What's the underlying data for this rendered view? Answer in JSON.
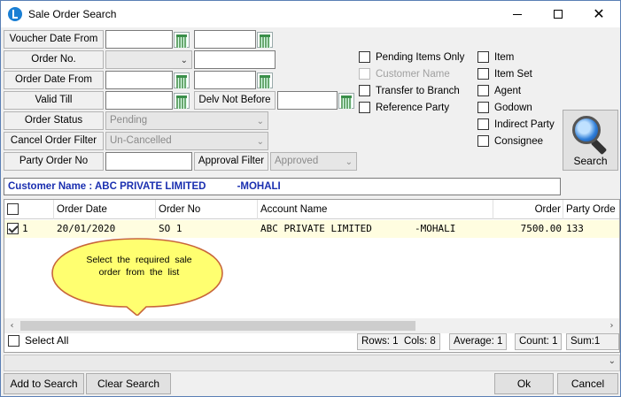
{
  "window": {
    "title": "Sale Order Search",
    "minimize_glyph": "",
    "maximize_glyph": "",
    "close_glyph": "✕"
  },
  "filters": {
    "voucher_date_from_label": "Voucher Date From",
    "order_no_label": "Order No.",
    "order_date_from_label": "Order Date From",
    "valid_till_label": "Valid Till",
    "delv_not_before_label": "Delv Not Before",
    "order_status_label": "Order Status",
    "order_status_value": "Pending",
    "cancel_order_filter_label": "Cancel Order Filter",
    "cancel_order_filter_value": "Un-Cancelled",
    "party_order_no_label": "Party Order No",
    "approval_filter_label": "Approval Filter",
    "approval_filter_value": "Approved"
  },
  "options_left": [
    {
      "label": "Pending Items Only",
      "enabled": true
    },
    {
      "label": "Customer Name",
      "enabled": false
    },
    {
      "label": "Transfer to Branch",
      "enabled": true
    },
    {
      "label": "Reference Party",
      "enabled": true
    }
  ],
  "options_right": [
    {
      "label": "Item"
    },
    {
      "label": "Item Set"
    },
    {
      "label": "Agent"
    },
    {
      "label": "Godown"
    },
    {
      "label": "Indirect Party"
    },
    {
      "label": "Consignee"
    }
  ],
  "search_button": {
    "label": "Search",
    "icon": "magnifier-icon"
  },
  "customer_bar": "Customer Name : ABC PRIVATE LIMITED           -MOHALI",
  "grid": {
    "columns": [
      "",
      "Order Date",
      "Order No",
      "Account Name",
      "Order",
      "Party Orde"
    ],
    "rows": [
      {
        "sr": "1",
        "order_date": "20/01/2020",
        "order_no": "SO  1",
        "account_name": "ABC PRIVATE LIMITED",
        "account_city": "-MOHALI",
        "order": "7500.00",
        "party_order": "133",
        "checked": true
      }
    ]
  },
  "callout": "Select the required sale order from the list",
  "select_all_label": "Select All",
  "status": {
    "rows": "Rows: 1",
    "cols": "Cols: 8",
    "average": "Average: 1",
    "count": "Count: 1",
    "sum": "Sum:1"
  },
  "buttons": {
    "add_to_search": "Add to Search",
    "clear_search": "Clear Search",
    "ok": "Ok",
    "cancel": "Cancel"
  }
}
